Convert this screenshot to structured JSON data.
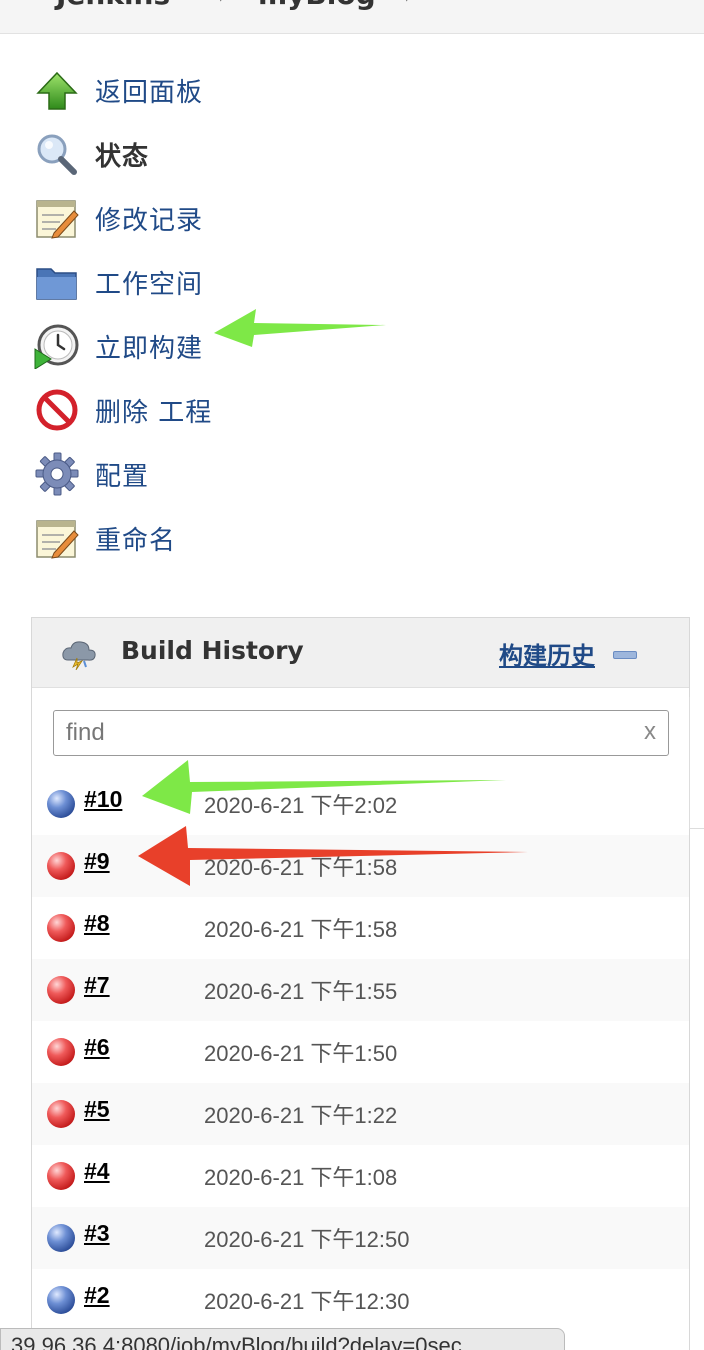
{
  "breadcrumb": {
    "root": "Jenkins",
    "job": "myBlog"
  },
  "menu": [
    {
      "label": "返回面板",
      "icon": "up-arrow-icon",
      "bold": false
    },
    {
      "label": "状态",
      "icon": "search-icon",
      "bold": true
    },
    {
      "label": "修改记录",
      "icon": "notepad-icon",
      "bold": false
    },
    {
      "label": "工作空间",
      "icon": "folder-icon",
      "bold": false
    },
    {
      "label": "立即构建",
      "icon": "clock-play-icon",
      "bold": false
    },
    {
      "label": "删除 工程",
      "icon": "no-entry-icon",
      "bold": false
    },
    {
      "label": "配置",
      "icon": "gear-icon",
      "bold": false
    },
    {
      "label": "重命名",
      "icon": "notepad-icon",
      "bold": false
    }
  ],
  "build_history": {
    "title": "Build History",
    "trend_link": "构建历史",
    "search": {
      "placeholder": "find",
      "value": "",
      "clear": "x"
    },
    "builds": [
      {
        "number": "#10",
        "time": "2020-6-21 下午2:02",
        "status": "blue"
      },
      {
        "number": "#9",
        "time": "2020-6-21 下午1:58",
        "status": "red"
      },
      {
        "number": "#8",
        "time": "2020-6-21 下午1:58",
        "status": "red"
      },
      {
        "number": "#7",
        "time": "2020-6-21 下午1:55",
        "status": "red"
      },
      {
        "number": "#6",
        "time": "2020-6-21 下午1:50",
        "status": "red"
      },
      {
        "number": "#5",
        "time": "2020-6-21 下午1:22",
        "status": "red"
      },
      {
        "number": "#4",
        "time": "2020-6-21 下午1:08",
        "status": "red"
      },
      {
        "number": "#3",
        "time": "2020-6-21 下午12:50",
        "status": "blue"
      },
      {
        "number": "#2",
        "time": "2020-6-21 下午12:30",
        "status": "blue"
      }
    ]
  },
  "status_bar": {
    "url": "39.96.36.4:8080/job/myBlog/build?delay=0sec"
  },
  "annotation_colors": {
    "green_arrow": "#7ee847",
    "red_arrow": "#e8402a"
  }
}
